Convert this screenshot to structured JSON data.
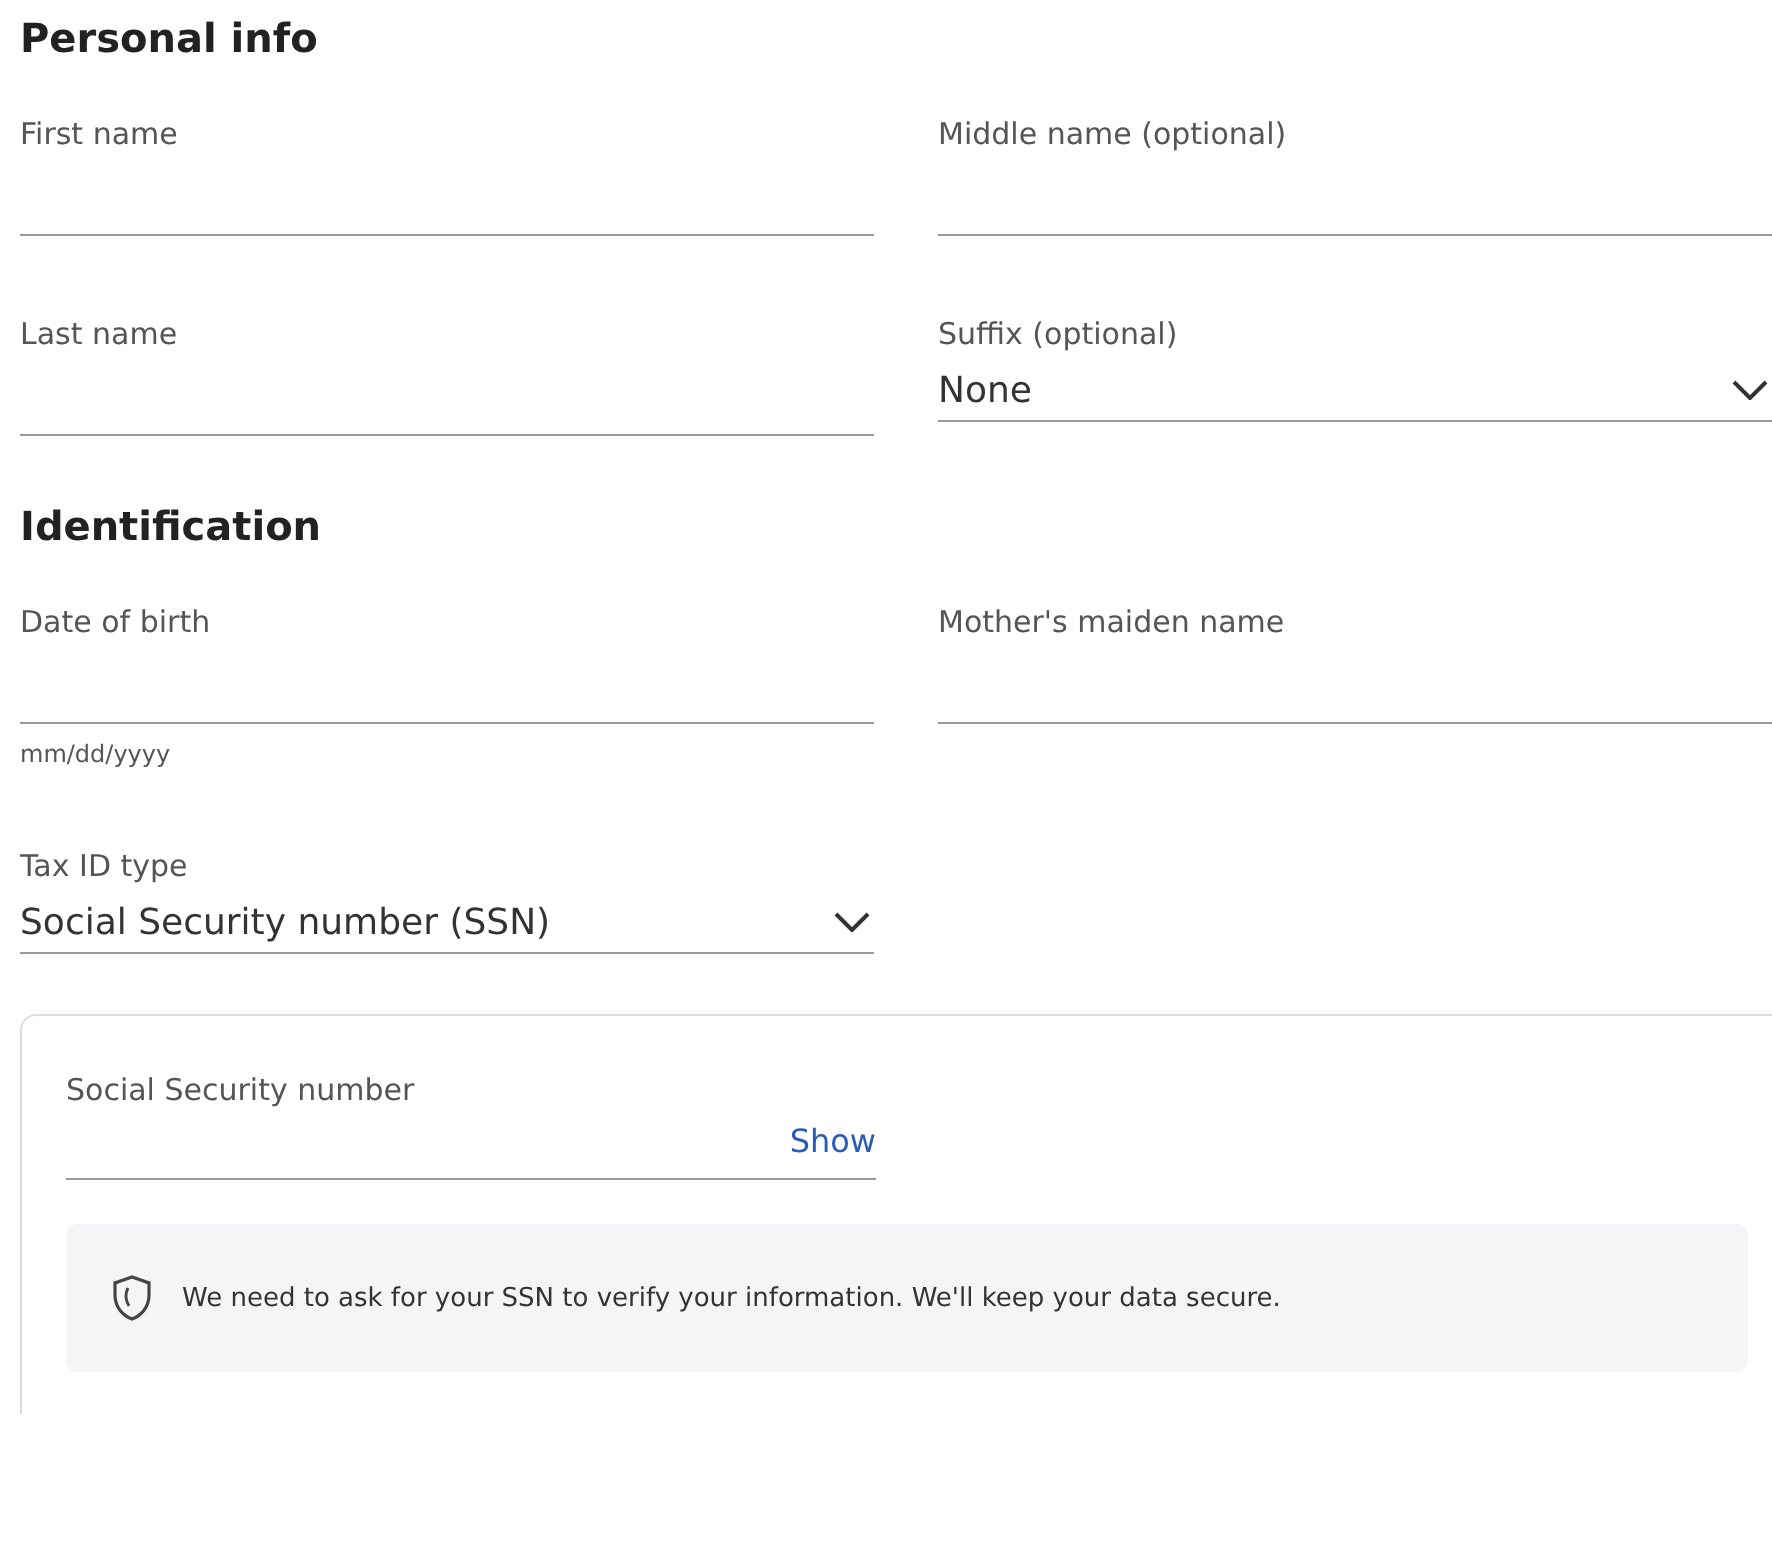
{
  "sections": [
    {
      "title": "Personal info",
      "fields": [
        {
          "kind": "text",
          "label": "First name"
        },
        {
          "kind": "text",
          "label": "Middle name (optional)"
        },
        {
          "kind": "text",
          "label": "Last name"
        },
        {
          "kind": "select",
          "label": "Suffix (optional)",
          "value": "None"
        }
      ]
    },
    {
      "title": "Identification",
      "fields": [
        {
          "kind": "text",
          "label": "Date of birth",
          "hint": "mm/dd/yyyy"
        },
        {
          "kind": "text",
          "label": "Mother's maiden name"
        },
        {
          "kind": "select",
          "label": "Tax ID type",
          "value": "Social Security number (SSN)"
        }
      ]
    }
  ],
  "ssn_card": {
    "label": "Social Security number",
    "action": "Show",
    "notice": "We need to ask for your SSN to verify your information. We'll keep your data secure."
  }
}
